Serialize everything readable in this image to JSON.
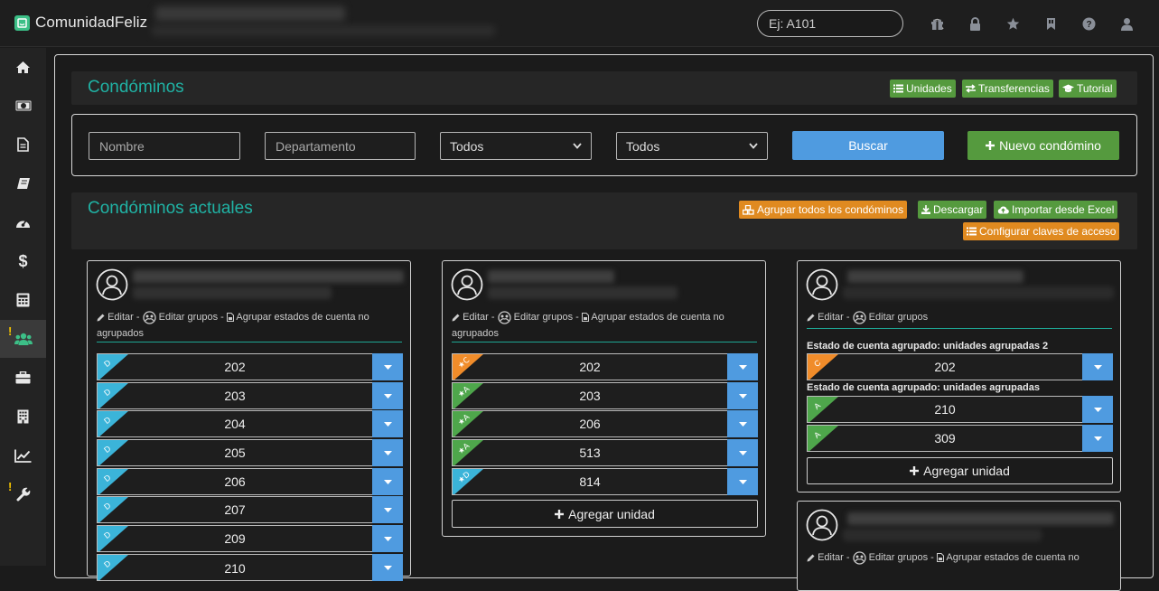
{
  "app": {
    "name": "ComunidadFeliz"
  },
  "search": {
    "placeholder": "Ej: A101"
  },
  "top_icons": [
    "gift-icon",
    "lock-icon",
    "star-icon",
    "bookmark-icon",
    "help-icon",
    "user-icon"
  ],
  "sidebar": {
    "items": [
      {
        "icon": "home-icon"
      },
      {
        "icon": "money-icon"
      },
      {
        "icon": "document-icon"
      },
      {
        "icon": "book-icon"
      },
      {
        "icon": "dashboard-icon"
      },
      {
        "icon": "dollar-icon"
      },
      {
        "icon": "calculator-icon"
      },
      {
        "icon": "users-icon",
        "active": true,
        "warning": "!"
      },
      {
        "icon": "briefcase-icon"
      },
      {
        "icon": "building-icon"
      },
      {
        "icon": "chart-icon"
      },
      {
        "icon": "wrench-icon",
        "warning": "!"
      }
    ]
  },
  "header": {
    "title": "Condóminos",
    "buttons": {
      "unidades": "Unidades",
      "transferencias": "Transferencias",
      "tutorial": "Tutorial"
    }
  },
  "filters": {
    "nombre_placeholder": "Nombre",
    "departamento_placeholder": "Departamento",
    "select1": "Todos",
    "select2": "Todos",
    "buscar": "Buscar",
    "nuevo": "Nuevo condómino"
  },
  "current": {
    "title": "Condóminos actuales",
    "buttons": {
      "agrupar": "Agrupar todos los condóminos",
      "descargar": "Descargar",
      "importar": "Importar desde Excel",
      "configurar": "Configurar claves de acceso"
    }
  },
  "labels": {
    "editar": "Editar",
    "editar_grupos": "Editar grupos",
    "agrupar_estados_1": "Agrupar estados de cuenta no",
    "agrupar_estados_2": "agrupados",
    "agregar_unidad": "Agregar unidad",
    "sep": "-"
  },
  "cards": [
    {
      "units": [
        {
          "number": "202",
          "tag": "D",
          "color": "#3bb4d9"
        },
        {
          "number": "203",
          "tag": "D",
          "color": "#3bb4d9"
        },
        {
          "number": "204",
          "tag": "D",
          "color": "#3bb4d9"
        },
        {
          "number": "205",
          "tag": "D",
          "color": "#3bb4d9"
        },
        {
          "number": "206",
          "tag": "D",
          "color": "#3bb4d9"
        },
        {
          "number": "207",
          "tag": "D",
          "color": "#3bb4d9"
        },
        {
          "number": "209",
          "tag": "D",
          "color": "#3bb4d9"
        },
        {
          "number": "210",
          "tag": "D",
          "color": "#3bb4d9"
        }
      ]
    },
    {
      "units": [
        {
          "number": "202",
          "tag": "★C",
          "color": "#f08c2a"
        },
        {
          "number": "203",
          "tag": "★A",
          "color": "#4ea64b"
        },
        {
          "number": "206",
          "tag": "★A",
          "color": "#4ea64b"
        },
        {
          "number": "513",
          "tag": "★A",
          "color": "#4ea64b"
        },
        {
          "number": "814",
          "tag": "★D",
          "color": "#3bb4d9"
        }
      ]
    },
    {
      "groups": [
        {
          "label": "Estado de cuenta agrupado: unidades agrupadas 2",
          "units": [
            {
              "number": "202",
              "tag": "C",
              "color": "#f08c2a"
            }
          ]
        },
        {
          "label": "Estado de cuenta agrupado: unidades agrupadas",
          "units": [
            {
              "number": "210",
              "tag": "A",
              "color": "#4ea64b"
            },
            {
              "number": "309",
              "tag": "A",
              "color": "#4ea64b"
            }
          ]
        }
      ]
    }
  ]
}
